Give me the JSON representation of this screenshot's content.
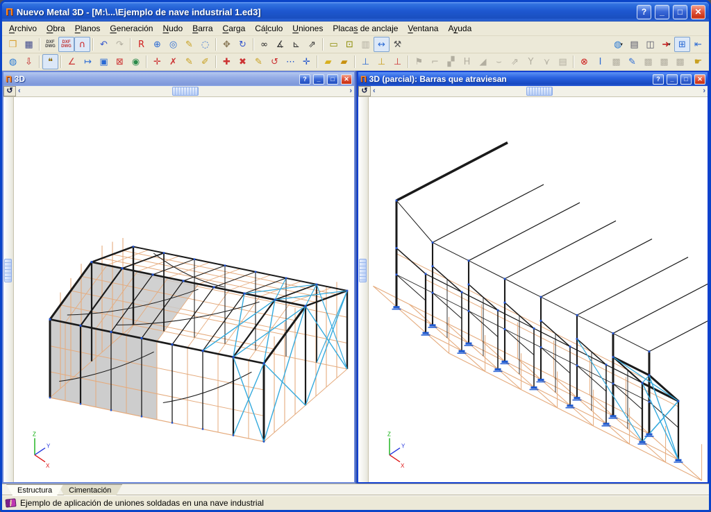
{
  "window": {
    "title": "Nuevo Metal 3D - [M:\\...\\Ejemplo de nave industrial 1.ed3]",
    "controls": {
      "help": "?",
      "minimize": "_",
      "maximize": "□",
      "close": "✕"
    }
  },
  "menu": {
    "items": [
      {
        "id": "archivo",
        "label": "Archivo",
        "accel": 0
      },
      {
        "id": "obra",
        "label": "Obra",
        "accel": 0
      },
      {
        "id": "planos",
        "label": "Planos",
        "accel": 0
      },
      {
        "id": "generacion",
        "label": "Generación",
        "accel": 0
      },
      {
        "id": "nudo",
        "label": "Nudo",
        "accel": 0
      },
      {
        "id": "barra",
        "label": "Barra",
        "accel": 0
      },
      {
        "id": "carga",
        "label": "Carga",
        "accel": 0
      },
      {
        "id": "calculo",
        "label": "Cálculo",
        "accel": 2
      },
      {
        "id": "uniones",
        "label": "Uniones",
        "accel": 0
      },
      {
        "id": "placas-de-anclaje",
        "label": "Placas de anclaje",
        "accel": 5
      },
      {
        "id": "ventana",
        "label": "Ventana",
        "accel": 0
      },
      {
        "id": "ayuda",
        "label": "Ayuda",
        "accel": 1
      }
    ]
  },
  "toolbar_top": {
    "items": [
      {
        "name": "open-icon",
        "glyph": "❒",
        "color": "#d8a030"
      },
      {
        "name": "save-icon",
        "glyph": "▦",
        "color": "#404a8c"
      },
      {
        "sep": true
      },
      {
        "name": "dxf-template-icon",
        "glyph": "DXF DWG",
        "text": true,
        "color": "#444444"
      },
      {
        "name": "dxf-layers-icon",
        "glyph": "DXF DWG",
        "text": true,
        "color": "#c03030",
        "state": "pressed"
      },
      {
        "name": "magnet-icon",
        "glyph": "∩",
        "color": "#cc2020",
        "state": "pressed"
      },
      {
        "sep": true
      },
      {
        "name": "undo-icon",
        "glyph": "↶",
        "color": "#3355cc"
      },
      {
        "name": "redo-icon",
        "glyph": "↷",
        "color": "#888888",
        "state": "disabled"
      },
      {
        "sep": true
      },
      {
        "name": "zoom-window-icon",
        "glyph": "R",
        "color": "#d02020"
      },
      {
        "name": "zoom-extents-icon",
        "glyph": "⊕",
        "color": "#2a6ad4"
      },
      {
        "name": "zoom-x2-icon",
        "glyph": "◎",
        "color": "#2a6ad4"
      },
      {
        "name": "redraw-icon",
        "glyph": "✎",
        "color": "#c8a020"
      },
      {
        "name": "zoom-previous-icon",
        "glyph": "◌",
        "color": "#2a6ad4"
      },
      {
        "sep": true
      },
      {
        "name": "pan-icon",
        "glyph": "✥",
        "color": "#887755"
      },
      {
        "name": "regenerate-icon",
        "glyph": "↻",
        "color": "#3355cc"
      },
      {
        "sep": true
      },
      {
        "name": "search-icon",
        "glyph": "∞",
        "color": "#222222"
      },
      {
        "name": "rotate-view-icon",
        "glyph": "∡",
        "color": "#333333"
      },
      {
        "name": "ortho-icon",
        "glyph": "⊾",
        "color": "#333333"
      },
      {
        "name": "measure-icon",
        "glyph": "⇗",
        "color": "#333333"
      },
      {
        "sep": true
      },
      {
        "name": "rectangle-icon",
        "glyph": "▭",
        "color": "#8a8a00"
      },
      {
        "name": "rectangle-center-icon",
        "glyph": "⊡",
        "color": "#8a8a00"
      },
      {
        "name": "panels-icon",
        "glyph": "▥",
        "color": "#888888",
        "state": "disabled"
      },
      {
        "name": "dimension-icon",
        "glyph": "↔",
        "color": "#2a6ad4",
        "state": "pressed"
      },
      {
        "name": "tools-icon",
        "glyph": "⚒",
        "color": "#555555"
      }
    ],
    "right_items": [
      {
        "name": "web-services-icon",
        "glyph": "◍",
        "color": "#2a7ad4",
        "caret": true
      },
      {
        "name": "print-icon",
        "glyph": "▤",
        "color": "#555566"
      },
      {
        "name": "capture-icon",
        "glyph": "◫",
        "color": "#555566"
      },
      {
        "name": "export-icon",
        "glyph": "➜",
        "color": "#c02020",
        "caret": true
      },
      {
        "name": "window-tile-icon",
        "glyph": "⊞",
        "color": "#2a6ad4",
        "state": "pressed"
      },
      {
        "name": "window-shift-icon",
        "glyph": "⇤",
        "color": "#2a6ad4"
      }
    ]
  },
  "toolbar_second": {
    "items": [
      {
        "name": "globe-icon",
        "glyph": "◍",
        "color": "#2a7ad4"
      },
      {
        "name": "import-icon",
        "glyph": "⇩",
        "color": "#c02020"
      },
      {
        "sep": true
      },
      {
        "name": "comments-icon",
        "glyph": "❝",
        "color": "#886600",
        "state": "pressed"
      },
      {
        "sep": true
      },
      {
        "name": "axes-icon",
        "glyph": "∠",
        "color": "#cc3333"
      },
      {
        "name": "dimension-add-icon",
        "glyph": "↦",
        "color": "#2a6ad4"
      },
      {
        "name": "group-select-icon",
        "glyph": "▣",
        "color": "#2a6ad4"
      },
      {
        "name": "group-delete-icon",
        "glyph": "⊠",
        "color": "#cc3333"
      },
      {
        "name": "view-axes-icon",
        "glyph": "◉",
        "color": "#2a8a4a"
      },
      {
        "sep": true
      },
      {
        "name": "node-add-icon",
        "glyph": "✛",
        "color": "#cc3333"
      },
      {
        "name": "node-delete-icon",
        "glyph": "✗",
        "color": "#cc3333"
      },
      {
        "name": "node-edit-icon",
        "glyph": "✎",
        "color": "#c8a020"
      },
      {
        "name": "support-edit-icon",
        "glyph": "✐",
        "color": "#c8a020"
      },
      {
        "sep": true
      },
      {
        "name": "bar-add-icon",
        "glyph": "✚",
        "color": "#cc3333"
      },
      {
        "name": "bar-delete-icon",
        "glyph": "✖",
        "color": "#cc3333"
      },
      {
        "name": "bar-edit-icon",
        "glyph": "✎",
        "color": "#c8a020"
      },
      {
        "name": "bar-rotate-icon",
        "glyph": "↺",
        "color": "#cc3333"
      },
      {
        "name": "bar-divide-icon",
        "glyph": "⋯",
        "color": "#2255cc"
      },
      {
        "name": "bar-node-icon",
        "glyph": "✛",
        "color": "#2255cc"
      },
      {
        "sep": true
      },
      {
        "name": "profile-series-icon",
        "glyph": "▰",
        "color": "#d8b020"
      },
      {
        "name": "profile-edit-icon",
        "glyph": "▰",
        "color": "#c89010"
      },
      {
        "sep": true
      },
      {
        "name": "buckling-add-icon",
        "glyph": "⊥",
        "color": "#2a6ad4"
      },
      {
        "name": "buckling-edit-icon",
        "glyph": "⊥",
        "color": "#c8a020"
      },
      {
        "name": "buckling-delete-icon",
        "glyph": "⊥",
        "color": "#cc3333"
      },
      {
        "sep": true
      },
      {
        "name": "label-icon",
        "glyph": "⚑",
        "color": "#888888",
        "state": "disabled"
      },
      {
        "name": "crane-icon",
        "glyph": "⌐",
        "color": "#888888",
        "state": "disabled"
      },
      {
        "name": "stairs-icon",
        "glyph": "▞",
        "color": "#888888",
        "state": "disabled"
      },
      {
        "name": "h-profile-icon",
        "glyph": "H",
        "color": "#888888",
        "state": "disabled"
      },
      {
        "name": "load-ramp-icon",
        "glyph": "◢",
        "color": "#888888",
        "state": "disabled"
      },
      {
        "name": "load-hammock-icon",
        "glyph": "⌣",
        "color": "#888888",
        "state": "disabled"
      },
      {
        "name": "load-slope-icon",
        "glyph": "⇗",
        "color": "#888888",
        "state": "disabled"
      },
      {
        "name": "tie-icon",
        "glyph": "Y",
        "color": "#888888",
        "state": "disabled"
      },
      {
        "name": "tie-delete-icon",
        "glyph": "⋎",
        "color": "#888888",
        "state": "disabled"
      },
      {
        "name": "list-icon",
        "glyph": "▤",
        "color": "#888888",
        "state": "disabled"
      },
      {
        "sep": true
      },
      {
        "name": "stop-calculation-icon",
        "glyph": "⊗",
        "color": "#cc1818"
      },
      {
        "name": "section-icon",
        "glyph": "I",
        "color": "#2a6ad4"
      },
      {
        "name": "joint-view-icon",
        "glyph": "▩",
        "color": "#888888",
        "state": "disabled"
      },
      {
        "name": "joint-edit-icon",
        "glyph": "✎",
        "color": "#2a6ad4"
      },
      {
        "name": "joint-copy-icon",
        "glyph": "▩",
        "color": "#888888",
        "state": "disabled"
      },
      {
        "name": "joint-apply-icon",
        "glyph": "▩",
        "color": "#888888",
        "state": "disabled"
      },
      {
        "name": "joint-delete-icon",
        "glyph": "▩",
        "color": "#888888",
        "state": "disabled"
      }
    ],
    "right_items": [
      {
        "name": "panel-hand-icon",
        "glyph": "☛",
        "color": "#c8a020"
      }
    ]
  },
  "viewports": {
    "left": {
      "title": "3D",
      "active": false
    },
    "right": {
      "title": "3D (parcial): Barras que atraviesan",
      "active": true
    },
    "controls": {
      "help": "?",
      "minimize": "_",
      "maximize": "□",
      "close": "✕"
    },
    "rotate_glyph": "↺",
    "arrow_left": "‹",
    "arrow_right": "›"
  },
  "axes": {
    "x": "X",
    "y": "Y",
    "z": "Z"
  },
  "tabs": [
    {
      "id": "estructura",
      "label": "Estructura",
      "active": true
    },
    {
      "id": "cimentacion",
      "label": "Cimentación",
      "active": false
    }
  ],
  "statusbar": {
    "text": "Ejemplo de aplicación de uniones soldadas en una nave industrial"
  },
  "colors": {
    "grid_orange": "#e5ab7d",
    "member_black": "#1a1a1a",
    "brace_cyan": "#35aadd",
    "node_blue": "#2050cc",
    "support_blue": "#1e5ad2",
    "shade_gray": "#c9c9c9",
    "axis_x_red": "#dd1111",
    "axis_y_blue": "#2233dd",
    "axis_z_green": "#00aa00"
  }
}
